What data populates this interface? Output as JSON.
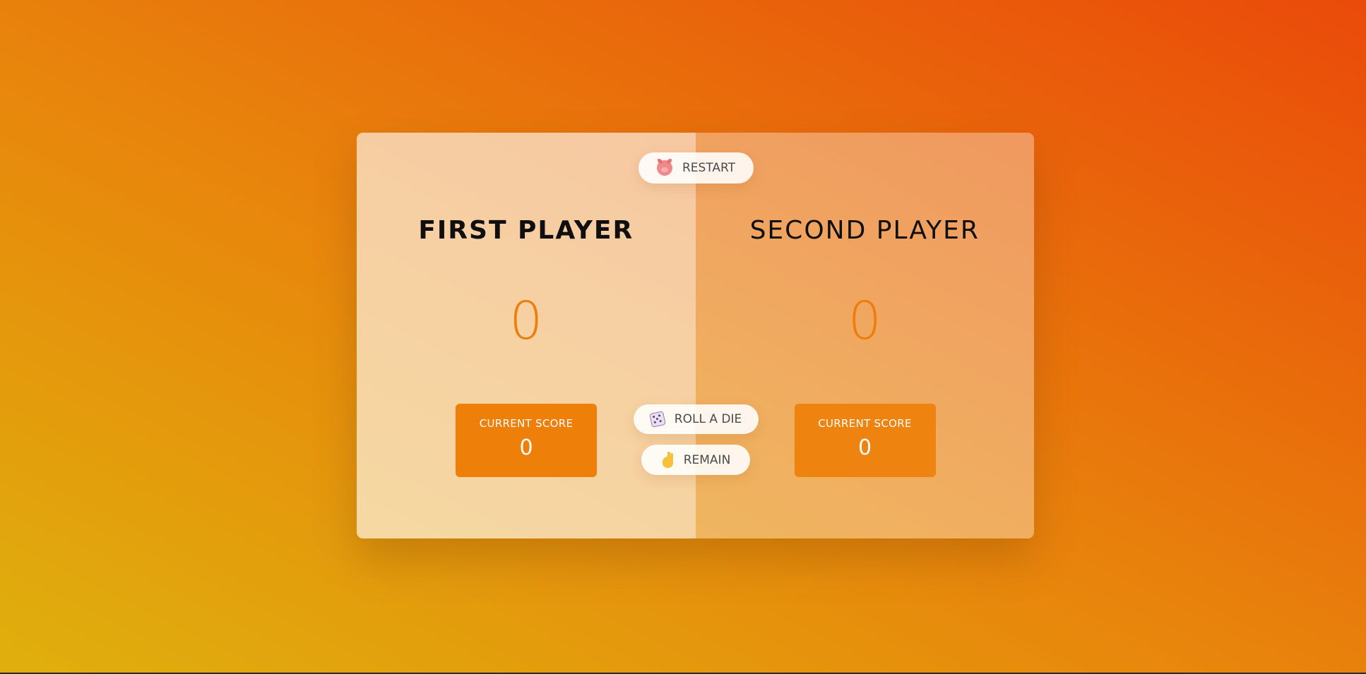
{
  "players": [
    {
      "name": "FIRST PLAYER",
      "score": "0",
      "current_label": "CURRENT SCORE",
      "current_score": "0",
      "active": true
    },
    {
      "name": "SECOND PLAYER",
      "score": "0",
      "current_label": "CURRENT SCORE",
      "current_score": "0",
      "active": false
    }
  ],
  "buttons": {
    "new_game": {
      "label": "RESTART",
      "icon": "pig-icon"
    },
    "roll": {
      "label": "ROLL A DIE",
      "icon": "die-icon"
    },
    "hold": {
      "label": "REMAIN",
      "icon": "ok-hand-icon"
    }
  },
  "colors": {
    "accent": "#ec7e0b",
    "current_box": "#ee7f08",
    "background_top_right": "#ea4a0a",
    "background_bottom_left": "#dfb00d"
  }
}
